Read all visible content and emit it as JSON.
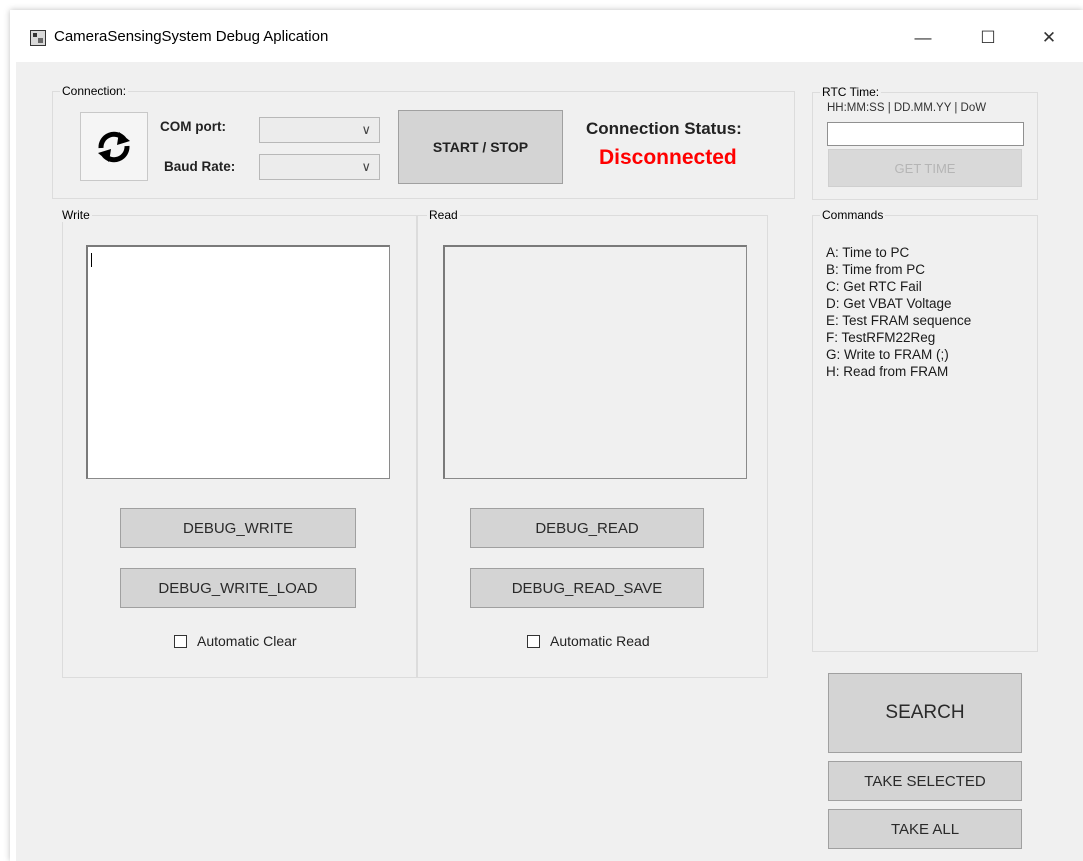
{
  "window": {
    "title": "CameraSensingSystem Debug Aplication",
    "controls": {
      "minimize": "—",
      "maximize": "☐",
      "close": "✕"
    }
  },
  "connection": {
    "group_label": "Connection:",
    "com_port_label": "COM port:",
    "baud_rate_label": "Baud Rate:",
    "com_port_value": "",
    "baud_rate_value": "",
    "start_stop_label": "START / STOP",
    "status_label": "Connection Status:",
    "status_value": "Disconnected",
    "status_color": "#ff0000"
  },
  "rtc": {
    "group_label": "RTC Time:",
    "format_label": "HH:MM:SS | DD.MM.YY | DoW",
    "time_value": "",
    "get_time_label": "GET TIME"
  },
  "write": {
    "group_label": "Write",
    "text_value": "",
    "debug_write_label": "DEBUG_WRITE",
    "debug_write_load_label": "DEBUG_WRITE_LOAD",
    "auto_clear_label": "Automatic Clear",
    "auto_clear_checked": false
  },
  "read": {
    "group_label": "Read",
    "text_value": "",
    "debug_read_label": "DEBUG_READ",
    "debug_read_save_label": "DEBUG_READ_SAVE",
    "auto_read_label": "Automatic Read",
    "auto_read_checked": false
  },
  "commands": {
    "group_label": "Commands",
    "items": [
      "A: Time to PC",
      "B: Time from PC",
      "C: Get RTC Fail",
      "D: Get VBAT Voltage",
      "E: Test FRAM  sequence",
      "F: TestRFM22Reg",
      "G: Write to FRAM (;)",
      "H: Read from FRAM"
    ]
  },
  "actions": {
    "search_label": "SEARCH",
    "take_selected_label": "TAKE SELECTED",
    "take_all_label": "TAKE ALL"
  },
  "icons": {
    "refresh": "refresh-icon",
    "app": "app-icon"
  }
}
